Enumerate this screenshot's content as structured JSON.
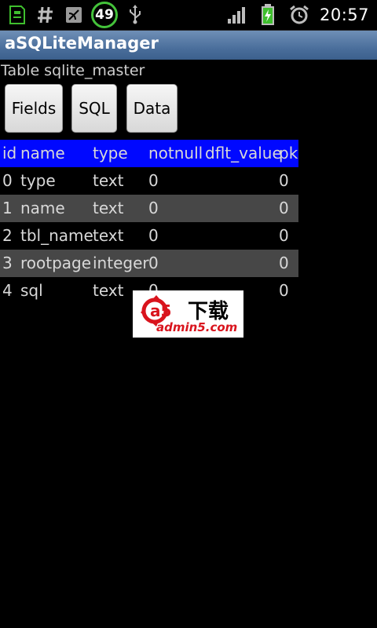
{
  "status_bar": {
    "battery_level": "49",
    "time": "20:57",
    "icons": [
      "sd-card-icon",
      "hash-icon",
      "usb-debug-icon",
      "usb-icon",
      "signal-icon",
      "battery-charging-icon",
      "alarm-icon"
    ]
  },
  "app": {
    "title": "aSQLiteManager",
    "title_bar_color": "#4b6f9c"
  },
  "table_caption": "Table sqlite_master",
  "buttons": {
    "fields": "Fields",
    "sql": "SQL",
    "data": "Data"
  },
  "grid": {
    "header_color": "#0008ff",
    "columns": [
      "id",
      "name",
      "type",
      "notnull",
      "dflt_value",
      "pk"
    ],
    "rows": [
      [
        "0",
        "type",
        "text",
        "0",
        "",
        "0"
      ],
      [
        "1",
        "name",
        "text",
        "0",
        "",
        "0"
      ],
      [
        "2",
        "tbl_name",
        "text",
        "0",
        "",
        "0"
      ],
      [
        "3",
        "rootpage",
        "integer",
        "0",
        "",
        "0"
      ],
      [
        "4",
        "sql",
        "text",
        "0",
        "",
        "0"
      ]
    ]
  },
  "watermark": {
    "logo_chars": "a5",
    "cn_text": "下载",
    "domain_text": "admin5.com"
  }
}
